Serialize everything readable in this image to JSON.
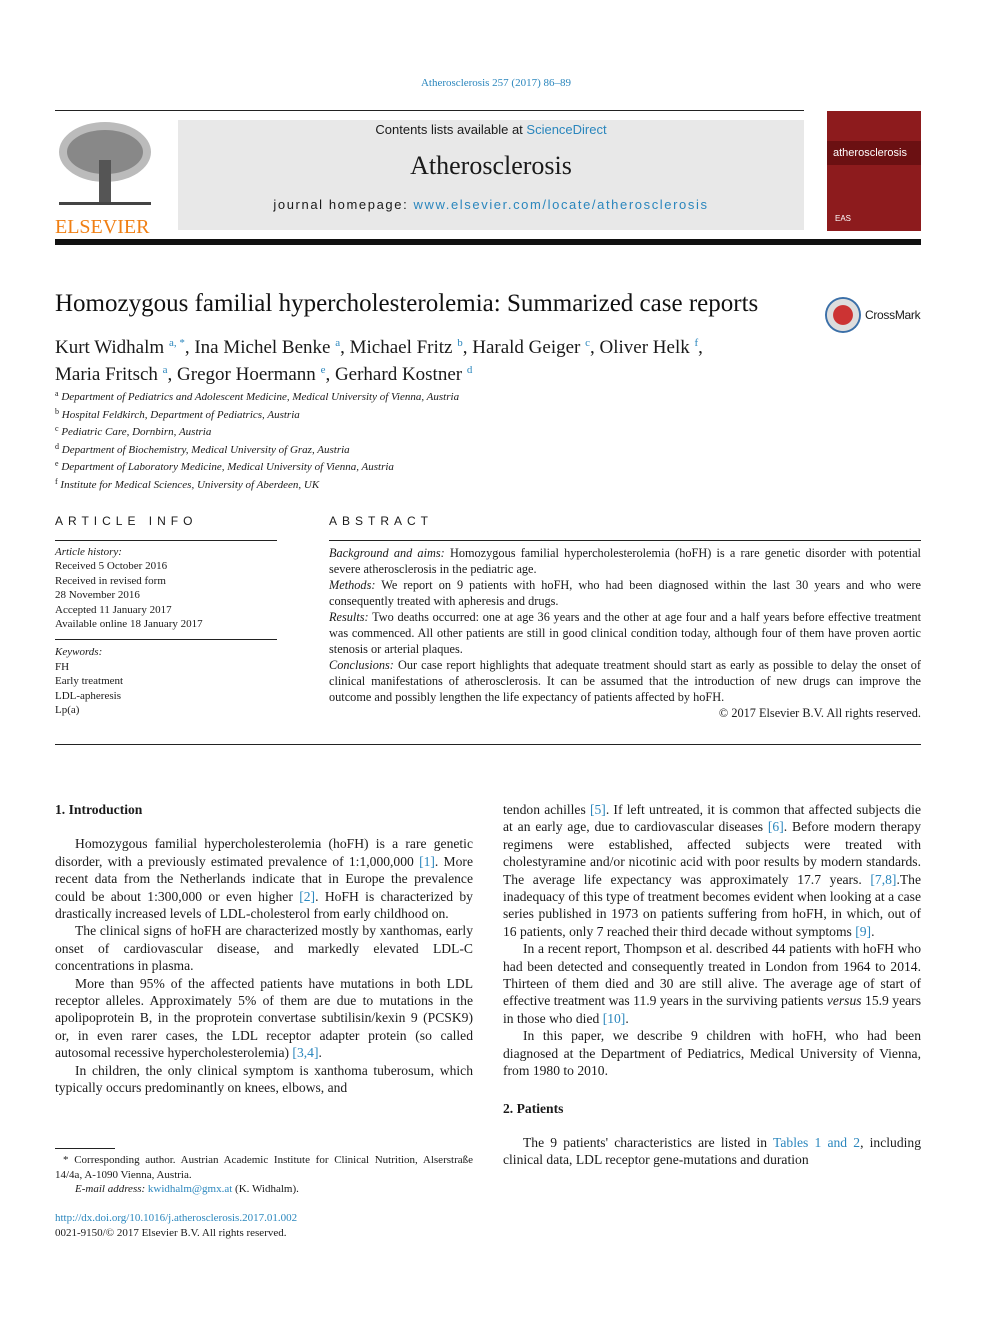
{
  "header": {
    "citation": "Atherosclerosis 257 (2017) 86–89",
    "publisher_logo_text": "ELSEVIER",
    "contents_prefix": "Contents lists available at ",
    "contents_link": "ScienceDirect",
    "journal_title": "Atherosclerosis",
    "homepage_prefix": "journal homepage: ",
    "homepage_link": "www.elsevier.com/locate/atherosclerosis",
    "cover_title": "atherosclerosis",
    "cover_society": "EAS",
    "colors": {
      "link": "#2a86bd",
      "elsevier_orange": "#f07f13",
      "cover_red": "#8d1b1d"
    }
  },
  "article": {
    "title": "Homozygous familial hypercholesterolemia: Summarized case reports",
    "crossmark": "CrossMark",
    "authors_line1": [
      {
        "name": "Kurt Widhalm",
        "sup": "a, *",
        "sep": ", "
      },
      {
        "name": "Ina Michel Benke",
        "sup": "a",
        "sep": ", "
      },
      {
        "name": "Michael Fritz",
        "sup": "b",
        "sep": ", "
      },
      {
        "name": "Harald Geiger",
        "sup": "c",
        "sep": ", "
      },
      {
        "name": "Oliver Helk",
        "sup": "f",
        "sep": ","
      }
    ],
    "authors_line2": [
      {
        "name": "Maria Fritsch",
        "sup": "a",
        "sep": ", "
      },
      {
        "name": "Gregor Hoermann",
        "sup": "e",
        "sep": ", "
      },
      {
        "name": "Gerhard Kostner",
        "sup": "d",
        "sep": ""
      }
    ],
    "affiliations": [
      {
        "key": "a",
        "text": "Department of Pediatrics and Adolescent Medicine, Medical University of Vienna, Austria"
      },
      {
        "key": "b",
        "text": "Hospital Feldkirch, Department of Pediatrics, Austria"
      },
      {
        "key": "c",
        "text": "Pediatric Care, Dornbirn, Austria"
      },
      {
        "key": "d",
        "text": "Department of Biochemistry, Medical University of Graz, Austria"
      },
      {
        "key": "e",
        "text": "Department of Laboratory Medicine, Medical University of Vienna, Austria"
      },
      {
        "key": "f",
        "text": "Institute for Medical Sciences, University of Aberdeen, UK"
      }
    ]
  },
  "article_info": {
    "heading": "ARTICLE INFO",
    "history_label": "Article history:",
    "history": [
      "Received 5 October 2016",
      "Received in revised form",
      "28 November 2016",
      "Accepted 11 January 2017",
      "Available online 18 January 2017"
    ],
    "keywords_label": "Keywords:",
    "keywords": [
      "FH",
      "Early treatment",
      "LDL-apheresis",
      "Lp(a)"
    ]
  },
  "abstract": {
    "heading": "ABSTRACT",
    "sections": [
      {
        "label": "Background and aims:",
        "text": "Homozygous familial hypercholesterolemia (hoFH) is a rare genetic disorder with potential severe atherosclerosis in the pediatric age."
      },
      {
        "label": "Methods:",
        "text": "We report on 9 patients with hoFH, who had been diagnosed within the last 30 years and who were consequently treated with apheresis and drugs."
      },
      {
        "label": "Results:",
        "text": "Two deaths occurred: one at age 36 years and the other at age four and a half years before effective treatment was commenced. All other patients are still in good clinical condition today, although four of them have proven aortic stenosis or arterial plaques."
      },
      {
        "label": "Conclusions:",
        "text": "Our case report highlights that adequate treatment should start as early as possible to delay the onset of clinical manifestations of atherosclerosis. It can be assumed that the introduction of new drugs can improve the outcome and possibly lengthen the life expectancy of patients affected by hoFH."
      }
    ],
    "copyright": "© 2017 Elsevier B.V. All rights reserved."
  },
  "body": {
    "intro_heading": "1.  Introduction",
    "left_paragraphs": [
      [
        {
          "t": "Homozygous familial hypercholesterolemia (hoFH) is a rare genetic disorder, with a previously estimated prevalence of 1:1,000,000 "
        },
        {
          "t": "[1]",
          "ref": true
        },
        {
          "t": ". More recent data from the Netherlands indicate that in Europe the prevalence could be about 1:300,000 or even higher "
        },
        {
          "t": "[2]",
          "ref": true
        },
        {
          "t": ". HoFH is characterized by drastically increased levels of LDL-cholesterol from early childhood on."
        }
      ],
      [
        {
          "t": "The clinical signs of hoFH are characterized mostly by xanthomas, early onset of cardiovascular disease, and markedly elevated LDL-C concentrations in plasma."
        }
      ],
      [
        {
          "t": "More than 95% of the affected patients have mutations in both LDL receptor alleles. Approximately 5% of them are due to mutations in the apolipoprotein B, in the proprotein convertase subtilisin/kexin 9 (PCSK9) or, in even rarer cases, the LDL receptor adapter protein (so called autosomal recessive hypercholesterolemia) "
        },
        {
          "t": "[3,4]",
          "ref": true
        },
        {
          "t": "."
        }
      ],
      [
        {
          "t": "In children, the only clinical symptom is xanthoma tuberosum, which typically occurs predominantly on knees, elbows, and"
        }
      ]
    ],
    "right_paragraphs": [
      [
        {
          "t": "tendon achilles "
        },
        {
          "t": "[5]",
          "ref": true
        },
        {
          "t": ". If left untreated, it is common that affected subjects die at an early age, due to cardiovascular diseases "
        },
        {
          "t": "[6]",
          "ref": true
        },
        {
          "t": ". Before modern therapy regimens were established, affected subjects were treated with cholestyramine and/or nicotinic acid with poor results by modern standards. The average life expectancy was approximately 17.7 years. "
        },
        {
          "t": "[7,8]",
          "ref": true
        },
        {
          "t": ".The inadequacy of this type of treatment becomes evident when looking at a case series published in 1973 on patients suffering from hoFH, in which, out of 16 patients, only 7 reached their third decade without symptoms "
        },
        {
          "t": "[9]",
          "ref": true
        },
        {
          "t": "."
        }
      ],
      [
        {
          "t": "In a recent report, Thompson et al. described 44 patients with hoFH who had been detected and consequently treated in London from 1964 to 2014. Thirteen of them died and 30 are still alive. The average age of start of effective treatment was 11.9 years in the surviving patients "
        },
        {
          "t": "versus",
          "em": true
        },
        {
          "t": " 15.9 years in those who died "
        },
        {
          "t": "[10]",
          "ref": true
        },
        {
          "t": "."
        }
      ],
      [
        {
          "t": "In this paper, we describe 9 children with hoFH, who had been diagnosed at the Department of Pediatrics, Medical University of Vienna, from 1980 to 2010."
        }
      ]
    ],
    "patients_heading": "2.  Patients",
    "patients_paragraph": [
      {
        "t": "The 9 patients' characteristics are listed in "
      },
      {
        "t": "Tables 1 and 2",
        "ref": true
      },
      {
        "t": ", including clinical data, LDL receptor gene-mutations and duration"
      }
    ]
  },
  "footnote": {
    "corresponding": "* Corresponding author. Austrian Academic Institute for Clinical Nutrition, Alserstraße 14/4a, A-1090 Vienna, Austria.",
    "email_label": "E-mail address:",
    "email": "kwidhalm@gmx.at",
    "email_suffix": " (K. Widhalm).",
    "doi": "http://dx.doi.org/10.1016/j.atherosclerosis.2017.01.002",
    "issn": "0021-9150/© 2017 Elsevier B.V. All rights reserved."
  }
}
